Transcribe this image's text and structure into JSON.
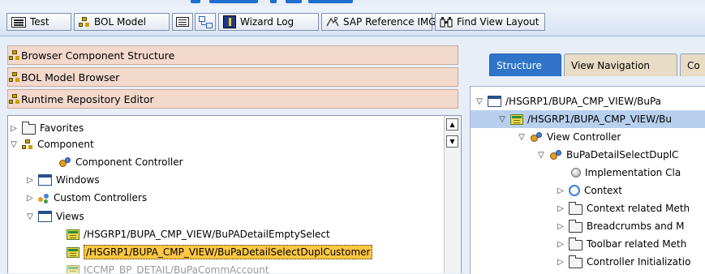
{
  "toolbar": {
    "test_label": "Test",
    "bol_model_label": "BOL Model",
    "wizard_log_label": "Wizard Log",
    "sap_reference_img_label": "SAP Reference IMG",
    "find_view_layout_label": "Find View Layout"
  },
  "left": {
    "accordion": {
      "browser_component_structure": "Browser Component Structure",
      "bol_model_browser": "BOL Model Browser",
      "runtime_repository_editor": "Runtime Repository Editor"
    },
    "tree": {
      "favorites": "Favorites",
      "component": "Component",
      "component_controller": "Component Controller",
      "windows": "Windows",
      "custom_controllers": "Custom Controllers",
      "views": "Views",
      "views_items": [
        "/HSGRP1/BUPA_CMP_VIEW/BuPADetailEmptySelect",
        "/HSGRP1/BUPA_CMP_VIEW/BuPaDetailSelectDuplCustomer",
        "ICCMP_BP_DETAIL/BuPaCommAccount"
      ]
    }
  },
  "right": {
    "tabs": [
      "Structure",
      "View Navigation",
      "Co"
    ],
    "tree": {
      "root": "/HSGRP1/BUPA_CMP_VIEW/BuPa",
      "view": "/HSGRP1/BUPA_CMP_VIEW/Bu",
      "view_controller": "View Controller",
      "controller_class": "BuPaDetailSelectDuplC",
      "implementation_class": "Implementation Cla",
      "context": "Context",
      "context_methods": "Context related Meth",
      "breadcrumbs": "Breadcrumbs and M",
      "toolbar_methods": "Toolbar related Meth",
      "controller_init": "Controller Initializatio"
    }
  },
  "colors": {
    "toolbar_bg": "#dce6f4",
    "accordion_bg": "#f3d9cc",
    "selected_row": "#ffc742",
    "active_tab": "#2f74c8",
    "highlight_row": "#b8d0ee"
  }
}
